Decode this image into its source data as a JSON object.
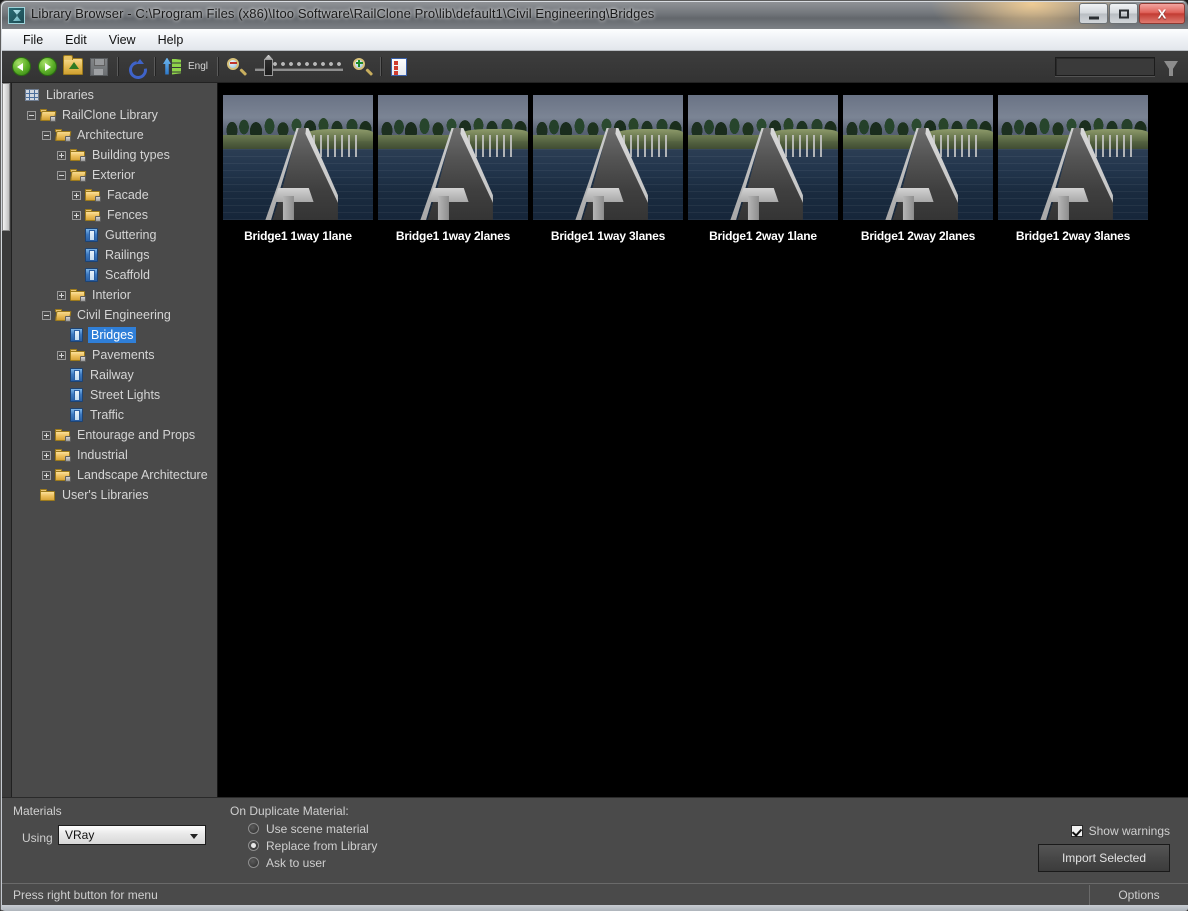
{
  "window": {
    "title": "Library Browser - C:\\Program Files (x86)\\Itoo Software\\RailClone Pro\\lib\\default1\\Civil Engineering\\Bridges",
    "icon": "app-icon",
    "minimize_label": "–",
    "maximize_label": "",
    "close_label": "X"
  },
  "menu": {
    "items": [
      {
        "label": "File"
      },
      {
        "label": "Edit"
      },
      {
        "label": "View"
      },
      {
        "label": "Help"
      }
    ]
  },
  "toolbar": {
    "buttons": [
      {
        "name": "back-button",
        "icon": "back-arrow-icon",
        "label": ""
      },
      {
        "name": "forward-button",
        "icon": "forward-arrow-icon",
        "label": ""
      },
      {
        "name": "open-folder-button",
        "icon": "folder-up-icon",
        "label": ""
      },
      {
        "name": "save-button",
        "icon": "save-icon",
        "label": ""
      },
      {
        "name": "refresh-button",
        "icon": "refresh-icon",
        "label": ""
      },
      {
        "name": "update-library-button",
        "icon": "update-arrow-icon",
        "label": "Engl"
      },
      {
        "name": "zoom-out-button",
        "icon": "magnifier-minus-icon",
        "label": ""
      },
      {
        "name": "zoom-in-button",
        "icon": "magnifier-plus-icon",
        "label": ""
      },
      {
        "name": "checklist-button",
        "icon": "checklist-icon",
        "label": ""
      }
    ],
    "engl_label": "Engl",
    "zoom_slider": {
      "value": 10,
      "min": 0,
      "max": 100
    },
    "search": {
      "value": "",
      "placeholder": ""
    },
    "filter_icon": "funnel-icon"
  },
  "sidebar": {
    "tree": [
      {
        "label": "Libraries",
        "indent": 0,
        "icon": "libraries-icon",
        "expander": "none",
        "selected": false
      },
      {
        "label": "RailClone Library",
        "indent": 1,
        "icon": "folder-open-icon",
        "expander": "minus",
        "selected": false
      },
      {
        "label": "Architecture",
        "indent": 2,
        "icon": "folder-open-icon",
        "expander": "minus",
        "selected": false
      },
      {
        "label": "Building types",
        "indent": 3,
        "icon": "folder-icon",
        "expander": "plus",
        "selected": false
      },
      {
        "label": "Exterior",
        "indent": 3,
        "icon": "folder-open-icon",
        "expander": "minus",
        "selected": false
      },
      {
        "label": "Facade",
        "indent": 4,
        "icon": "folder-icon",
        "expander": "plus",
        "selected": false
      },
      {
        "label": "Fences",
        "indent": 4,
        "icon": "folder-icon",
        "expander": "plus",
        "selected": false
      },
      {
        "label": "Guttering",
        "indent": 4,
        "icon": "document-icon",
        "expander": "none",
        "selected": false
      },
      {
        "label": "Railings",
        "indent": 4,
        "icon": "document-icon",
        "expander": "none",
        "selected": false
      },
      {
        "label": "Scaffold",
        "indent": 4,
        "icon": "document-icon",
        "expander": "none",
        "selected": false
      },
      {
        "label": "Interior",
        "indent": 3,
        "icon": "folder-icon",
        "expander": "plus",
        "selected": false
      },
      {
        "label": "Civil Engineering",
        "indent": 2,
        "icon": "folder-open-icon",
        "expander": "minus",
        "selected": false
      },
      {
        "label": "Bridges",
        "indent": 3,
        "icon": "document-icon",
        "expander": "none",
        "selected": true
      },
      {
        "label": "Pavements",
        "indent": 3,
        "icon": "folder-icon",
        "expander": "plus",
        "selected": false
      },
      {
        "label": "Railway",
        "indent": 3,
        "icon": "document-icon",
        "expander": "none",
        "selected": false
      },
      {
        "label": "Street Lights",
        "indent": 3,
        "icon": "document-icon",
        "expander": "none",
        "selected": false
      },
      {
        "label": "Traffic",
        "indent": 3,
        "icon": "document-icon",
        "expander": "none",
        "selected": false
      },
      {
        "label": "Entourage and Props",
        "indent": 2,
        "icon": "folder-icon",
        "expander": "plus",
        "selected": false
      },
      {
        "label": "Industrial",
        "indent": 2,
        "icon": "folder-icon",
        "expander": "plus",
        "selected": false
      },
      {
        "label": "Landscape Architecture",
        "indent": 2,
        "icon": "folder-icon",
        "expander": "plus",
        "selected": false
      },
      {
        "label": "User's Libraries",
        "indent": 1,
        "icon": "folder-plain-icon",
        "expander": "none",
        "selected": false
      }
    ],
    "hscroll": {
      "left_arrow": "◀",
      "right_arrow": "▶"
    }
  },
  "content": {
    "items": [
      {
        "label": "Bridge1 1way 1lane"
      },
      {
        "label": "Bridge1 1way 2lanes"
      },
      {
        "label": "Bridge1 1way 3lanes"
      },
      {
        "label": "Bridge1 2way 1lane"
      },
      {
        "label": "Bridge1 2way 2lanes"
      },
      {
        "label": "Bridge1 2way 3lanes"
      }
    ]
  },
  "bottom": {
    "materials_label": "Materials",
    "using_label": "Using",
    "material_renderer": "VRay",
    "material_options": [
      "VRay"
    ],
    "duplicate_label": "On Duplicate Material:",
    "duplicate_options": [
      {
        "label": "Use scene material",
        "selected": false
      },
      {
        "label": "Replace from Library",
        "selected": true
      },
      {
        "label": "Ask to user",
        "selected": false
      }
    ],
    "show_warnings_label": "Show warnings",
    "show_warnings_checked": true,
    "import_label": "Import Selected"
  },
  "statusbar": {
    "message": "Press right button for menu",
    "options_label": "Options"
  },
  "colors": {
    "selection_blue": "#2f7fd8",
    "panel_gray": "#4a4a4a",
    "content_black": "#000000",
    "toolbar_dark": "#3d3d3d"
  }
}
